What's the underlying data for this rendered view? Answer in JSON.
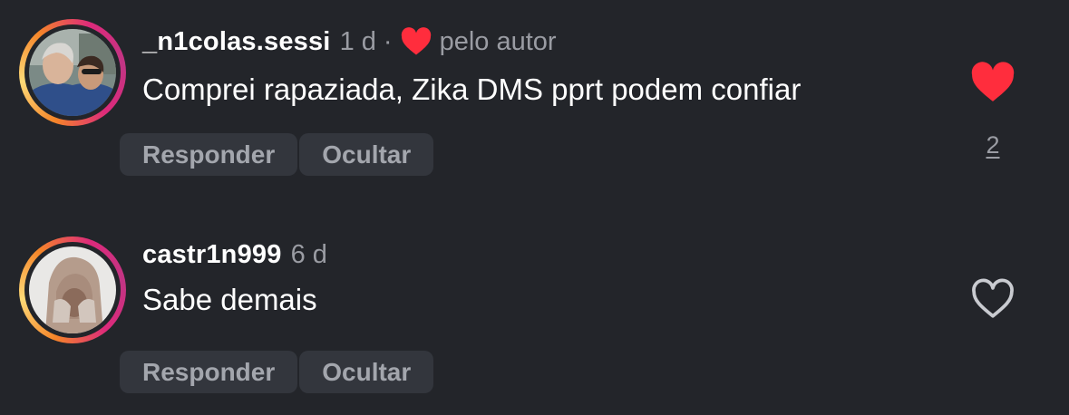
{
  "comments": [
    {
      "username": "_n1colas.sessi",
      "time": "1 d",
      "separator": "·",
      "author_like_label": "pelo autor",
      "text": "Comprei rapaziada, Zika DMS pprt podem confiar",
      "reply_label": "Responder",
      "hide_label": "Ocultar",
      "liked": true,
      "like_count": "2"
    },
    {
      "username": "castr1n999",
      "time": "6 d",
      "text": "Sabe demais",
      "reply_label": "Responder",
      "hide_label": "Ocultar",
      "liked": false
    }
  ],
  "icons": {
    "author_like": "heart-filled-icon",
    "like_filled": "heart-filled-icon",
    "like_outline": "heart-outline-icon"
  },
  "colors": {
    "background": "#23252a",
    "heart_red": "#ff2d3d",
    "muted_text": "#9a9ca3",
    "button_bg": "#33363d"
  }
}
